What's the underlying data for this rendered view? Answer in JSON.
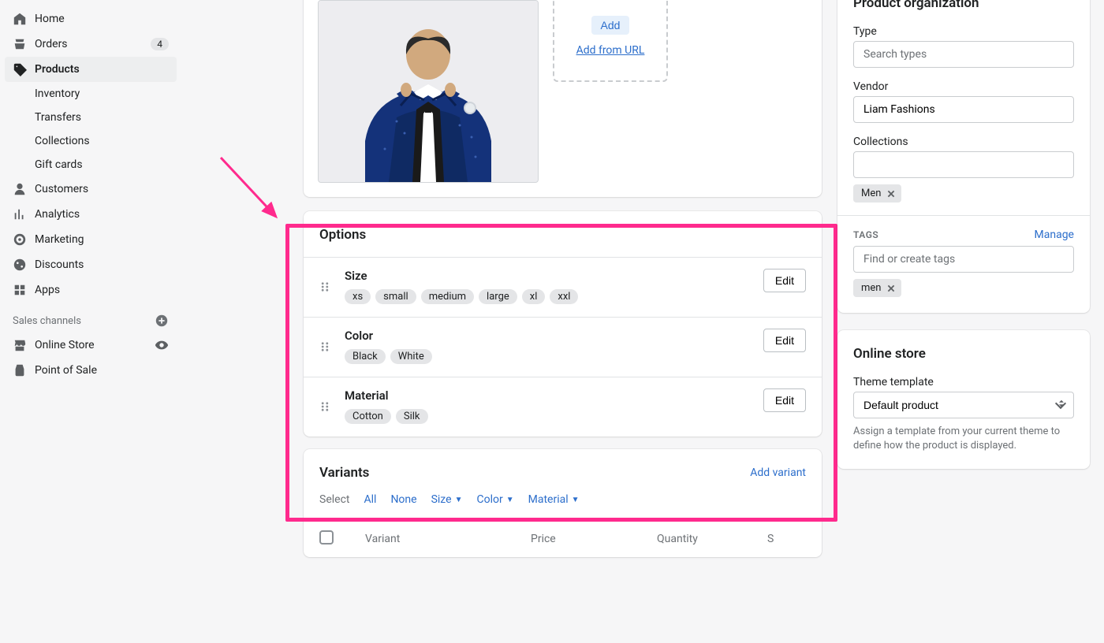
{
  "sidebar": {
    "items": [
      {
        "label": "Home",
        "icon": "home"
      },
      {
        "label": "Orders",
        "icon": "orders",
        "badge": "4"
      },
      {
        "label": "Products",
        "icon": "products",
        "active": true
      },
      {
        "label": "Inventory",
        "sub": true
      },
      {
        "label": "Transfers",
        "sub": true
      },
      {
        "label": "Collections",
        "sub": true
      },
      {
        "label": "Gift cards",
        "sub": true
      },
      {
        "label": "Customers",
        "icon": "customers"
      },
      {
        "label": "Analytics",
        "icon": "analytics"
      },
      {
        "label": "Marketing",
        "icon": "marketing"
      },
      {
        "label": "Discounts",
        "icon": "discounts"
      },
      {
        "label": "Apps",
        "icon": "apps"
      }
    ],
    "sales_channels_label": "Sales channels",
    "channels": [
      {
        "label": "Online Store",
        "icon": "store",
        "has_eye": true
      },
      {
        "label": "Point of Sale",
        "icon": "pos"
      }
    ]
  },
  "media": {
    "add_label": "Add",
    "add_url_label": "Add from URL"
  },
  "options_card": {
    "title": "Options",
    "edit_label": "Edit",
    "rows": [
      {
        "name": "Size",
        "values": [
          "xs",
          "small",
          "medium",
          "large",
          "xl",
          "xxl"
        ]
      },
      {
        "name": "Color",
        "values": [
          "Black",
          "White"
        ]
      },
      {
        "name": "Material",
        "values": [
          "Cotton",
          "Silk"
        ]
      }
    ]
  },
  "variants_card": {
    "title": "Variants",
    "add_variant_label": "Add variant",
    "select_label": "Select",
    "filters": [
      "All",
      "None",
      "Size",
      "Color",
      "Material"
    ],
    "columns": {
      "variant": "Variant",
      "price": "Price",
      "quantity": "Quantity",
      "s": "S"
    }
  },
  "org": {
    "title": "Product organization",
    "type_label": "Type",
    "type_placeholder": "Search types",
    "vendor_label": "Vendor",
    "vendor_value": "Liam Fashions",
    "collections_label": "Collections",
    "collections_tag": "Men",
    "tags_title": "TAGS",
    "manage_label": "Manage",
    "tags_placeholder": "Find or create tags",
    "tags_tag": "men"
  },
  "online_store": {
    "title": "Online store",
    "template_label": "Theme template",
    "template_value": "Default product",
    "helper": "Assign a template from your current theme to define how the product is displayed."
  }
}
